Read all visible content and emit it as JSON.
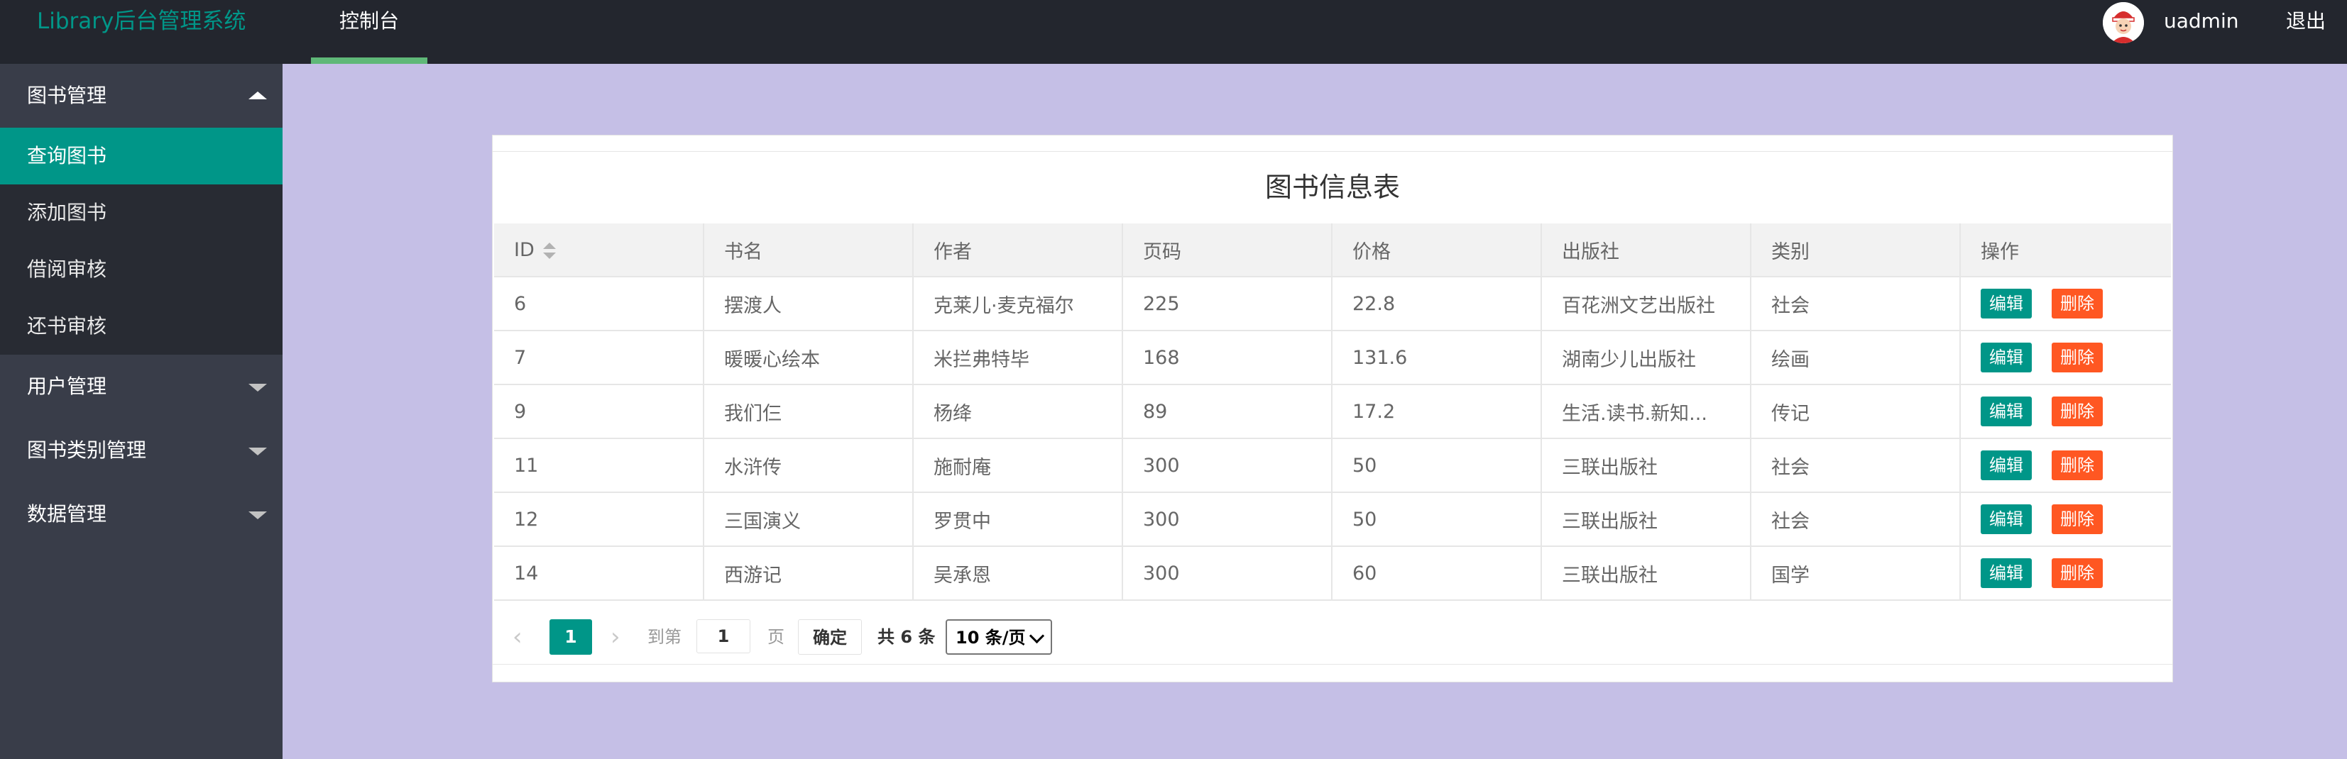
{
  "app": {
    "title": "Library后台管理系统"
  },
  "header": {
    "nav": {
      "console": "控制台"
    },
    "user": {
      "name": "uadmin",
      "avatar_icon": "user-avatar-icon"
    },
    "logout": "退出"
  },
  "sidebar": {
    "groups": [
      {
        "label": "图书管理",
        "expanded": true,
        "items": [
          {
            "label": "查询图书",
            "active": true
          },
          {
            "label": "添加图书"
          },
          {
            "label": "借阅审核"
          },
          {
            "label": "还书审核"
          }
        ]
      },
      {
        "label": "用户管理",
        "expanded": false
      },
      {
        "label": "图书类别管理",
        "expanded": false
      },
      {
        "label": "数据管理",
        "expanded": false
      }
    ]
  },
  "table": {
    "title": "图书信息表",
    "columns": [
      "ID",
      "书名",
      "作者",
      "页码",
      "价格",
      "出版社",
      "类别",
      "操作"
    ],
    "rows": [
      [
        "6",
        "摆渡人",
        "克莱儿·麦克福尔",
        "225",
        "22.8",
        "百花洲文艺出版社",
        "社会"
      ],
      [
        "7",
        "暖暖心绘本",
        "米拦弗特毕",
        "168",
        "131.6",
        "湖南少儿出版社",
        "绘画"
      ],
      [
        "9",
        "我们仨",
        "杨绛",
        "89",
        "17.2",
        "生活.读书.新知...",
        "传记"
      ],
      [
        "11",
        "水浒传",
        "施耐庵",
        "300",
        "50",
        "三联出版社",
        "社会"
      ],
      [
        "12",
        "三国演义",
        "罗贯中",
        "300",
        "50",
        "三联出版社",
        "社会"
      ],
      [
        "14",
        "西游记",
        "吴承恩",
        "300",
        "60",
        "三联出版社",
        "国学"
      ]
    ],
    "actions": {
      "edit": "编辑",
      "delete": "删除"
    }
  },
  "pager": {
    "current_page": "1",
    "goto_label": "到第",
    "goto_value": "1",
    "page_label": "页",
    "confirm": "确定",
    "total": "共 6 条",
    "page_size": "10 条/页"
  },
  "colors": {
    "accent": "#009688",
    "danger": "#ff5722",
    "header_bg": "#23262e",
    "sidebar_bg": "#393d49",
    "content_bg": "#c5bfe6",
    "nav_underline": "#5fb878"
  }
}
